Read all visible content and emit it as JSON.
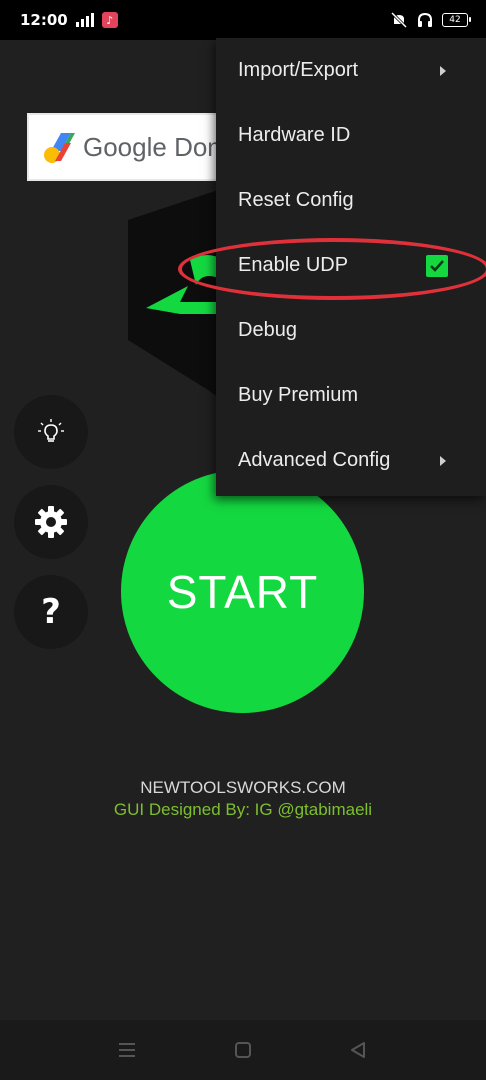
{
  "status_bar": {
    "time": "12:00",
    "battery": "42",
    "icons": [
      "signal-icon",
      "music-app-icon",
      "mute-icon",
      "headphones-icon",
      "battery-icon"
    ]
  },
  "ad": {
    "text": "Google Dom",
    "icon": "google-domains-logo"
  },
  "side_buttons": {
    "icons": [
      "lightbulb-icon",
      "gear-icon",
      "question-icon"
    ],
    "help_glyph": "?"
  },
  "start": {
    "label": "START",
    "color": "#14d840"
  },
  "footer": {
    "site": "NEWTOOLSWORKS.COM",
    "credit": "GUI  Designed By: IG @gtabimaeli",
    "credit_color": "#7dbf2e"
  },
  "menu": {
    "items": [
      {
        "label": "Import/Export",
        "submenu": true
      },
      {
        "label": "Hardware ID"
      },
      {
        "label": "Reset Config"
      },
      {
        "label": "Enable UDP",
        "checked": true
      },
      {
        "label": "Debug"
      },
      {
        "label": "Buy Premium"
      },
      {
        "label": "Advanced Config",
        "submenu": true
      }
    ]
  },
  "annotation": {
    "color": "#e0313a",
    "target": "Enable UDP"
  },
  "nav_bar": {
    "icons": [
      "menu-icon",
      "home-icon",
      "back-icon"
    ]
  }
}
